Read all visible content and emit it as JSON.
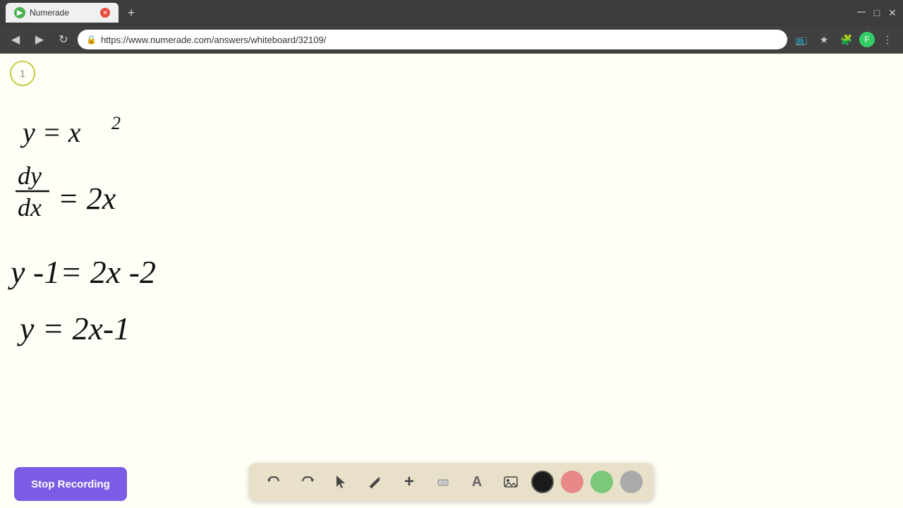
{
  "browser": {
    "tab_title": "Numerade",
    "tab_favicon": "N",
    "url": "https://www.numerade.com/answers/whiteboard/32109/",
    "new_tab_label": "+",
    "nav": {
      "back": "◀",
      "forward": "▶",
      "reload": "↻"
    }
  },
  "toolbar": {
    "stop_recording_label": "Stop Recording",
    "buttons": [
      {
        "name": "undo",
        "icon": "↩",
        "label": "Undo"
      },
      {
        "name": "redo",
        "icon": "↪",
        "label": "Redo"
      },
      {
        "name": "select",
        "icon": "↖",
        "label": "Select"
      },
      {
        "name": "pencil",
        "icon": "✏",
        "label": "Pencil"
      },
      {
        "name": "plus",
        "icon": "+",
        "label": "Add"
      },
      {
        "name": "eraser",
        "icon": "⌫",
        "label": "Eraser"
      },
      {
        "name": "text",
        "icon": "A",
        "label": "Text"
      },
      {
        "name": "image",
        "icon": "🖼",
        "label": "Image"
      }
    ],
    "colors": [
      {
        "name": "black",
        "value": "#1a1a1a"
      },
      {
        "name": "pink",
        "value": "#e88"
      },
      {
        "name": "green",
        "value": "#7bc87b"
      },
      {
        "name": "gray",
        "value": "#aaa"
      }
    ]
  },
  "page": {
    "step_number": "1",
    "background_color": "#fffff8"
  }
}
